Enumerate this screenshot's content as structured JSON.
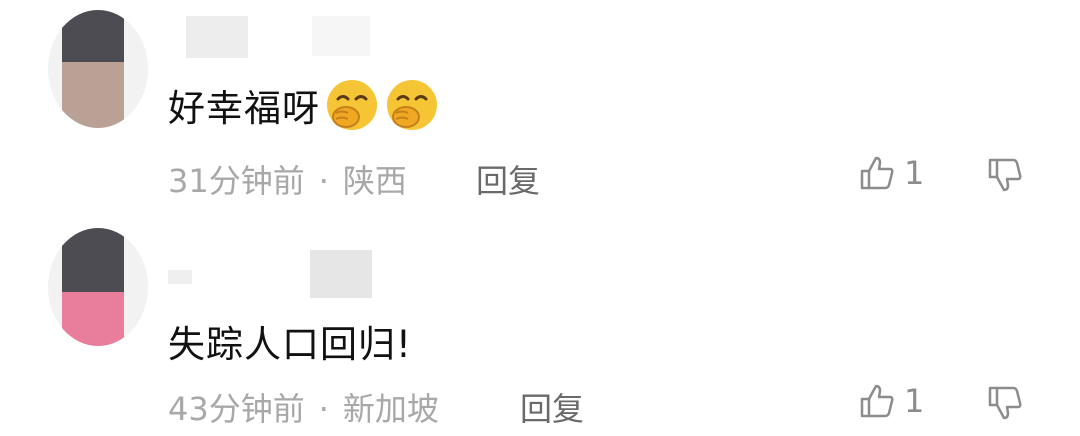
{
  "comments": [
    {
      "text": "好幸福呀",
      "emojis": [
        "hand-over-mouth-emoji",
        "hand-over-mouth-emoji"
      ],
      "time": "31分钟前",
      "separator": "·",
      "location": "陕西",
      "reply_label": "回复",
      "like_count": "1"
    },
    {
      "text": "失踪人口回归!",
      "emojis": [],
      "time": "43分钟前",
      "separator": "·",
      "location": "新加坡",
      "reply_label": "回复",
      "like_count": "1"
    }
  ],
  "icons": {
    "like": "thumbs-up-icon",
    "dislike": "thumbs-down-icon"
  },
  "colors": {
    "meta_text": "#a8a8a8",
    "reply_text": "#6a6a6a",
    "content_text": "#111111",
    "emoji_face": "#f6c536"
  }
}
